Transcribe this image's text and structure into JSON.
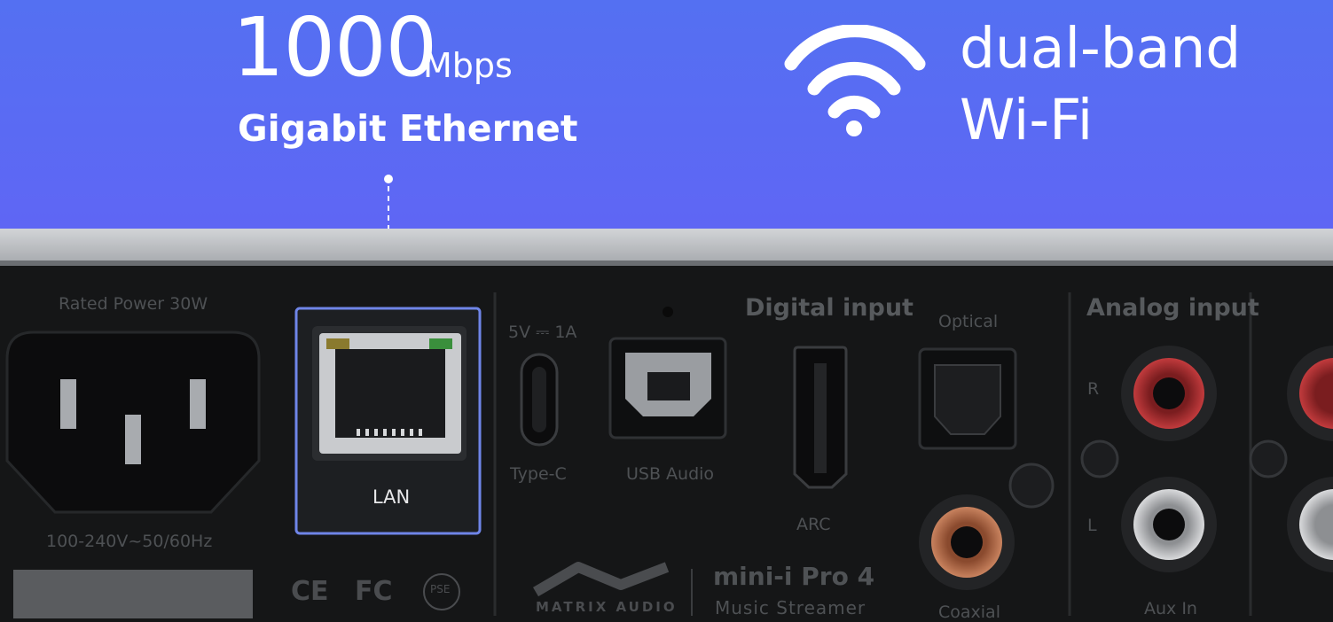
{
  "ethernet": {
    "speed": "1000",
    "unit": "Mbps",
    "label": "Gigabit Ethernet"
  },
  "wifi": {
    "icon": "wifi-icon",
    "line1": "dual-band",
    "line2": "Wi-Fi"
  },
  "device": {
    "rated_power": "Rated Power 30W",
    "voltage": "100-240V~50/60Hz",
    "lan_label": "LAN",
    "usbc_power": "5V ⎓ 1A",
    "typec_label": "Type-C",
    "usb_audio_label": "USB Audio",
    "digital_input": "Digital input",
    "optical": "Optical",
    "arc": "ARC",
    "coaxial": "Coaxial",
    "analog_input": "Analog input",
    "ch_r": "R",
    "ch_l": "L",
    "aux_in": "Aux In",
    "brand": "MATRIX AUDIO",
    "model": "mini-i Pro 4",
    "model_sub": "Music Streamer",
    "cert_ce": "CE",
    "cert_fc": "FC",
    "cert_pse": "PSE"
  },
  "colors": {
    "banner": "#5a6af3",
    "panel": "#151617",
    "silver": "#b9bcc0",
    "highlight": "#6f85e8"
  }
}
